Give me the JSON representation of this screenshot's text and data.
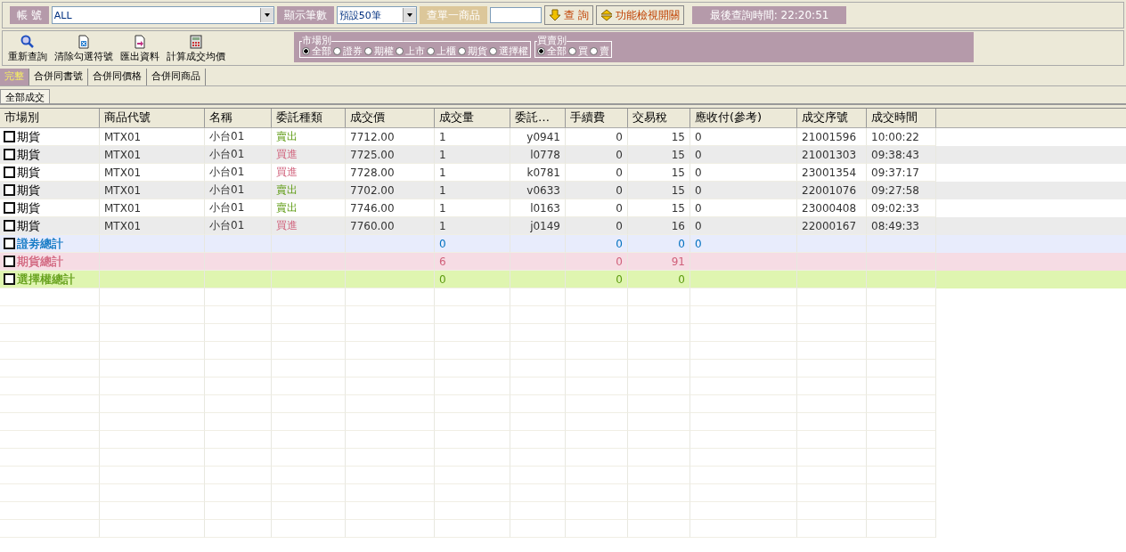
{
  "query_bar": {
    "account_label": "帳 號",
    "account_value": "ALL",
    "count_label": "顯示筆數",
    "count_value": "預設50筆",
    "single_label": "查單一商品",
    "query_button": "查 詢",
    "toggle_button": "功能檢視開關",
    "last_query": "最後查詢時間: 22:20:51"
  },
  "toolbar": [
    {
      "label": "重新查詢",
      "kind": "search"
    },
    {
      "label": "清除勾選符號",
      "kind": "clear"
    },
    {
      "label": "匯出資料",
      "kind": "export"
    },
    {
      "label": "計算成交均價",
      "kind": "calc"
    }
  ],
  "market_filter": {
    "title": "市場別",
    "options": [
      {
        "label": "全部",
        "selected": true
      },
      {
        "label": "證券",
        "selected": false
      },
      {
        "label": "期權",
        "selected": false
      },
      {
        "label": "上市",
        "selected": false
      },
      {
        "label": "上櫃",
        "selected": false
      },
      {
        "label": "期貨",
        "selected": false
      },
      {
        "label": "選擇權",
        "selected": false
      }
    ]
  },
  "side_filter": {
    "title": "買賣別",
    "options": [
      {
        "label": "全部",
        "selected": true
      },
      {
        "label": "買",
        "selected": false
      },
      {
        "label": "賣",
        "selected": false
      }
    ]
  },
  "tabs": [
    {
      "label": "完整",
      "selected": true
    },
    {
      "label": "合併同書號",
      "selected": false
    },
    {
      "label": "合併同價格",
      "selected": false
    },
    {
      "label": "合併同商品",
      "selected": false
    }
  ],
  "sub_tabs": [
    {
      "label": "全部成交",
      "selected": true
    }
  ],
  "table": {
    "columns": [
      "市場別",
      "商品代號",
      "名稱",
      "委託種類",
      "成交價",
      "成交量",
      "委託…",
      "手續費",
      "交易稅",
      "應收付(參考)",
      "成交序號",
      "成交時間"
    ],
    "rows": [
      {
        "kind": "sell",
        "checked": false,
        "cells": [
          "期貨",
          "MTX01",
          "小台01",
          "賣出",
          "7712.00",
          "1",
          "y0941",
          "0",
          "15",
          "0",
          "21001596",
          "10:00:22"
        ]
      },
      {
        "kind": "buy",
        "checked": false,
        "cells": [
          "期貨",
          "MTX01",
          "小台01",
          "買進",
          "7725.00",
          "1",
          "l0778",
          "0",
          "15",
          "0",
          "21001303",
          "09:38:43"
        ]
      },
      {
        "kind": "buy",
        "checked": false,
        "cells": [
          "期貨",
          "MTX01",
          "小台01",
          "買進",
          "7728.00",
          "1",
          "k0781",
          "0",
          "15",
          "0",
          "23001354",
          "09:37:17"
        ]
      },
      {
        "kind": "sell",
        "checked": false,
        "cells": [
          "期貨",
          "MTX01",
          "小台01",
          "賣出",
          "7702.00",
          "1",
          "v0633",
          "0",
          "15",
          "0",
          "22001076",
          "09:27:58"
        ]
      },
      {
        "kind": "sell",
        "checked": false,
        "cells": [
          "期貨",
          "MTX01",
          "小台01",
          "賣出",
          "7746.00",
          "1",
          "l0163",
          "0",
          "15",
          "0",
          "23000408",
          "09:02:33"
        ]
      },
      {
        "kind": "buy",
        "checked": false,
        "cells": [
          "期貨",
          "MTX01",
          "小台01",
          "買進",
          "7760.00",
          "1",
          "j0149",
          "0",
          "16",
          "0",
          "22000167",
          "08:49:33"
        ]
      },
      {
        "kind": "total",
        "checked": false,
        "color": "#0070c0",
        "cells": [
          "證劵總計",
          "",
          "",
          "",
          "",
          "0",
          "",
          "0",
          "0",
          "0",
          "",
          ""
        ]
      },
      {
        "kind": "total",
        "checked": false,
        "color": "#d0607a",
        "cells": [
          "期貨總計",
          "",
          "",
          "",
          "",
          "6",
          "",
          "0",
          "91",
          "",
          "",
          ""
        ]
      },
      {
        "kind": "total",
        "checked": false,
        "color": "#5c9a10",
        "cells": [
          "選擇權總計",
          "",
          "",
          "",
          "",
          "0",
          "",
          "0",
          "0",
          "",
          "",
          ""
        ]
      }
    ]
  }
}
